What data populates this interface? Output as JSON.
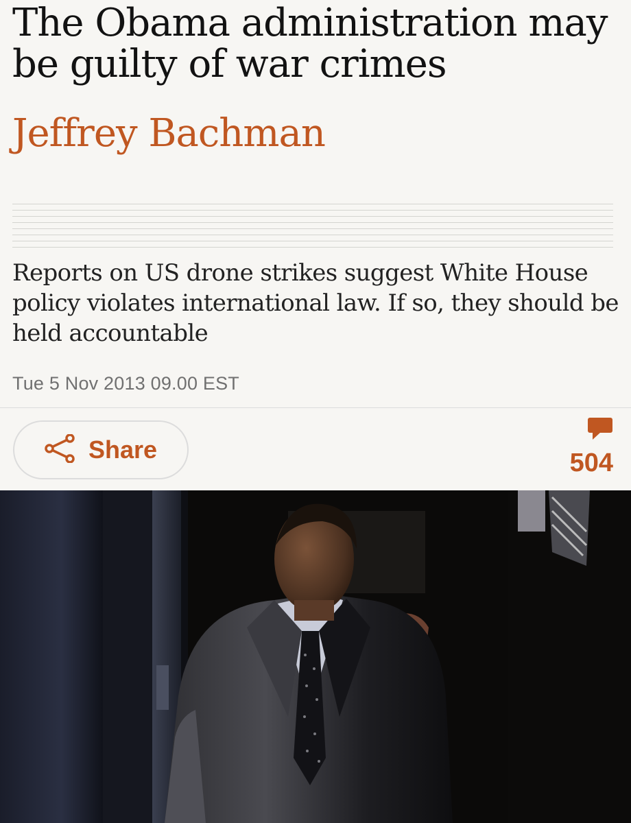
{
  "article": {
    "headline": "The Obama administration may be guilty of war crimes",
    "author": "Jeffrey Bachman",
    "standfirst": "Reports on US drone strikes suggest White House policy violates international law. If so, they should be held accountable",
    "dateline": "Tue 5 Nov 2013 09.00 EST"
  },
  "actions": {
    "share_label": "Share",
    "share_icon": "share-icon",
    "comment_icon": "speech-bubble-icon",
    "comment_count": "504"
  },
  "colors": {
    "accent": "#c05721",
    "background": "#f7f6f3",
    "text": "#121212"
  }
}
